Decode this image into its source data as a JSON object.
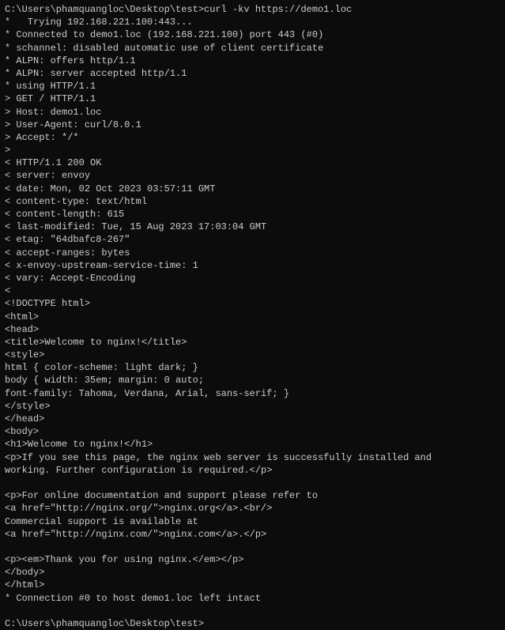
{
  "terminal": {
    "lines": [
      "C:\\Users\\phamquangloc\\Desktop\\test>curl -kv https://demo1.loc",
      "*   Trying 192.168.221.100:443...",
      "* Connected to demo1.loc (192.168.221.100) port 443 (#0)",
      "* schannel: disabled automatic use of client certificate",
      "* ALPN: offers http/1.1",
      "* ALPN: server accepted http/1.1",
      "* using HTTP/1.1",
      "> GET / HTTP/1.1",
      "> Host: demo1.loc",
      "> User-Agent: curl/8.0.1",
      "> Accept: */*",
      ">",
      "< HTTP/1.1 200 OK",
      "< server: envoy",
      "< date: Mon, 02 Oct 2023 03:57:11 GMT",
      "< content-type: text/html",
      "< content-length: 615",
      "< last-modified: Tue, 15 Aug 2023 17:03:04 GMT",
      "< etag: \"64dbafc8-267\"",
      "< accept-ranges: bytes",
      "< x-envoy-upstream-service-time: 1",
      "< vary: Accept-Encoding",
      "<",
      "<!DOCTYPE html>",
      "<html>",
      "<head>",
      "<title>Welcome to nginx!</title>",
      "<style>",
      "html { color-scheme: light dark; }",
      "body { width: 35em; margin: 0 auto;",
      "font-family: Tahoma, Verdana, Arial, sans-serif; }",
      "</style>",
      "</head>",
      "<body>",
      "<h1>Welcome to nginx!</h1>",
      "<p>If you see this page, the nginx web server is successfully installed and",
      "working. Further configuration is required.</p>",
      "",
      "<p>For online documentation and support please refer to",
      "<a href=\"http://nginx.org/\">nginx.org</a>.<br/>",
      "Commercial support is available at",
      "<a href=\"http://nginx.com/\">nginx.com</a>.</p>",
      "",
      "<p><em>Thank you for using nginx.</em></p>",
      "</body>",
      "</html>",
      "* Connection #0 to host demo1.loc left intact",
      "",
      "C:\\Users\\phamquangloc\\Desktop\\test>"
    ]
  }
}
